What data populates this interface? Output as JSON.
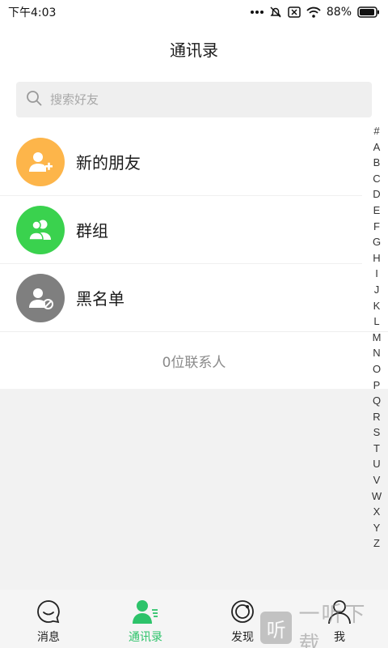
{
  "status_bar": {
    "time": "下午4:03",
    "battery": "88%",
    "icons": [
      "more-dots-icon",
      "mute-alarm-icon",
      "sim-blocked-icon",
      "wifi-icon",
      "battery-icon"
    ]
  },
  "header": {
    "title": "通讯录"
  },
  "search": {
    "placeholder": "搜索好友",
    "value": ""
  },
  "list": {
    "items": [
      {
        "label": "新的朋友",
        "icon": "add-user-icon",
        "color": "#fdb54a"
      },
      {
        "label": "群组",
        "icon": "group-icon",
        "color": "#3ad24e"
      },
      {
        "label": "黑名单",
        "icon": "blocked-user-icon",
        "color": "#7f7f7f"
      }
    ],
    "count_text": "0位联系人"
  },
  "alphabet": [
    "#",
    "A",
    "B",
    "C",
    "D",
    "E",
    "F",
    "G",
    "H",
    "I",
    "J",
    "K",
    "L",
    "M",
    "N",
    "O",
    "P",
    "Q",
    "R",
    "S",
    "T",
    "U",
    "V",
    "W",
    "X",
    "Y",
    "Z"
  ],
  "bottom_nav": {
    "items": [
      {
        "label": "消息",
        "icon": "chat-bubble-icon"
      },
      {
        "label": "通讯录",
        "icon": "contacts-icon",
        "active": true
      },
      {
        "label": "发现",
        "icon": "discover-icon"
      },
      {
        "label": "我",
        "icon": "profile-icon"
      }
    ],
    "active_color": "#2dc36a"
  },
  "watermark": {
    "glyph": "听",
    "text": "一听下载"
  }
}
